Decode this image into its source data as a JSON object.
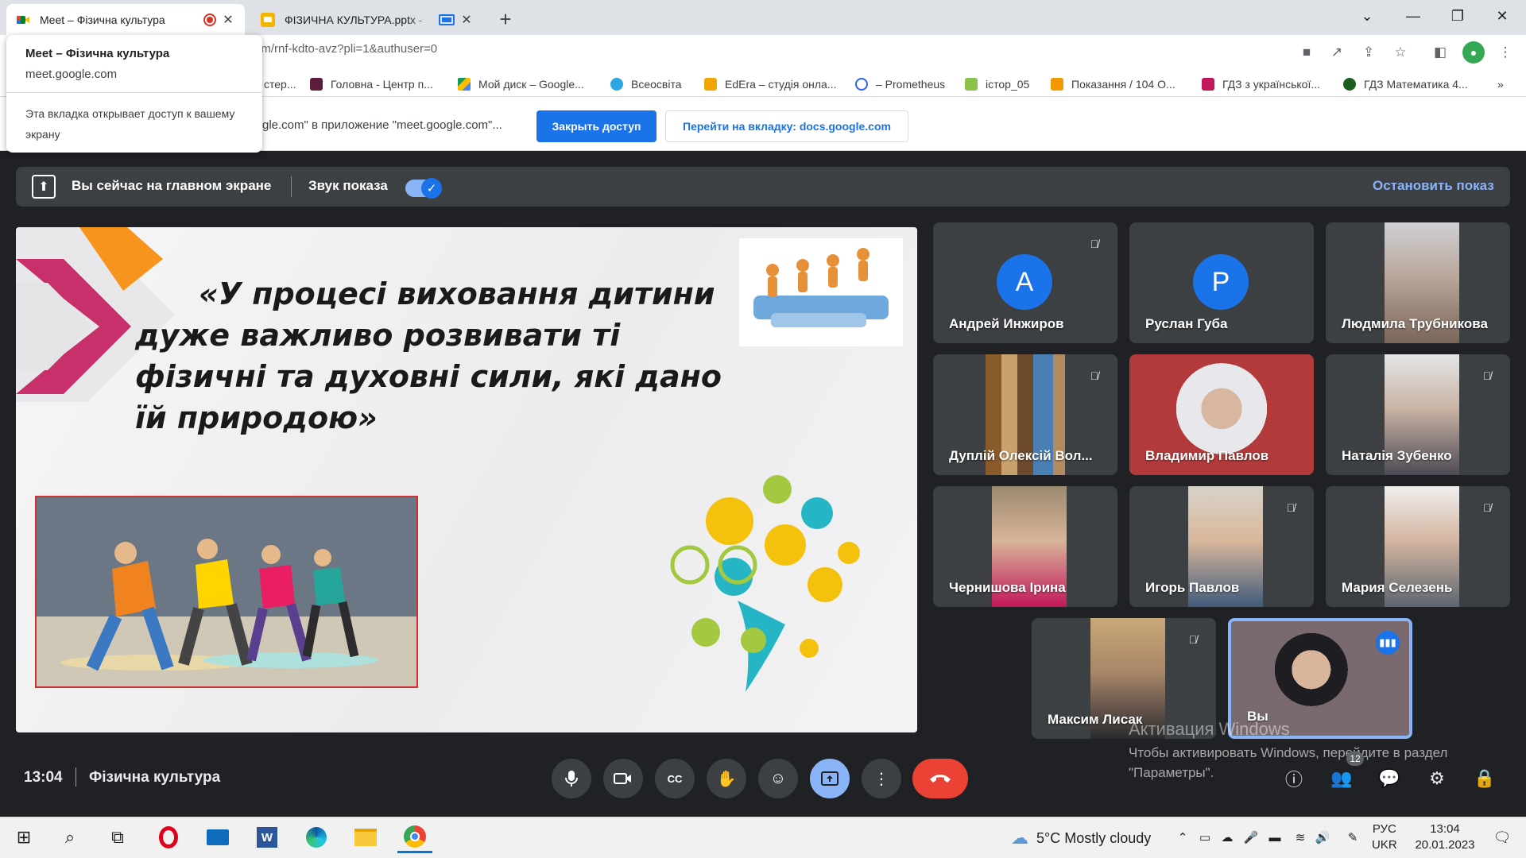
{
  "browser": {
    "tabs": [
      {
        "title": "Meet – Фізична культура",
        "active": true
      },
      {
        "title": "ФІЗИЧНА КУЛЬТУРА.pptx - ",
        "active": false
      }
    ],
    "url": "om/rnf-kdto-avz?pli=1&authuser=0",
    "bookmarks": [
      "стер...",
      "Головна - Центр п...",
      "Мой диск – Google...",
      "Всеосвіта",
      "EdEra – студія онла...",
      "– Prometheus",
      "істор_05",
      "Показання / 104 О...",
      "ГДЗ з української...",
      "ГДЗ Математика 4..."
    ]
  },
  "popup": {
    "title": "Meet – Фізична культура",
    "domain": "meet.google.com",
    "note": "Эта вкладка открывает доступ к вашему экрану"
  },
  "infobar": {
    "text": "gle.com\" в приложение \"meet.google.com\"...",
    "stop_button": "Закрыть доступ",
    "switch_button": "Перейти на вкладку: docs.google.com"
  },
  "presenting": {
    "status": "Вы сейчас на главном экране",
    "sound_label": "Звук показа",
    "sound_on": true,
    "stop": "Остановить показ"
  },
  "slide": {
    "quote": "«У процесі виховання дитини дуже важливо розвивати ті фізичні та духовні сили, які дано їй природою»"
  },
  "participants": [
    {
      "name": "Андрей Инжиров",
      "avatar_letter": "A",
      "avatar_color": "#1a73e8",
      "muted": true
    },
    {
      "name": "Руслан Губа",
      "avatar_letter": "P",
      "avatar_color": "#1a73e8",
      "muted": false
    },
    {
      "name": "Людмила Трубникова",
      "muted": false
    },
    {
      "name": "Дуплій Олексій Вол...",
      "muted": true
    },
    {
      "name": "Владимир Павлов",
      "muted": false
    },
    {
      "name": "Наталія Зубенко",
      "muted": true
    },
    {
      "name": "Чернишова Ірина",
      "muted": false
    },
    {
      "name": "Игорь Павлов",
      "muted": true
    },
    {
      "name": "Мария Селезень",
      "muted": true
    },
    {
      "name": "Максим Лисак",
      "muted": true
    },
    {
      "name": "Вы",
      "muted": false,
      "speaking": true
    }
  ],
  "meeting": {
    "time": "13:04",
    "title": "Фізична культура",
    "participant_count": "12"
  },
  "watermark": {
    "title": "Активация Windows",
    "text": "Чтобы активировать Windows, перейдите в раздел \"Параметры\"."
  },
  "taskbar": {
    "weather": "5°C  Mostly cloudy",
    "lang_top": "РУС",
    "lang_bottom": "UKR",
    "time": "13:04",
    "date": "20.01.2023"
  },
  "colors": {
    "accent": "#1a73e8",
    "end_call": "#ea4335",
    "meet_bg": "#202124"
  }
}
